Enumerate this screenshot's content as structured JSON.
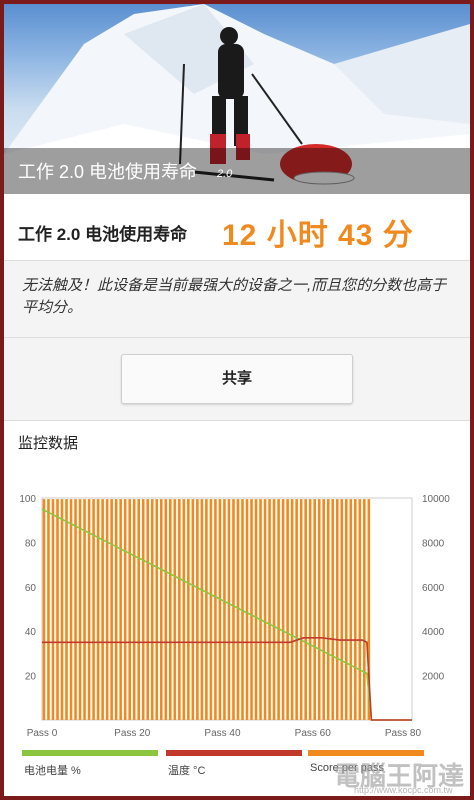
{
  "hero": {
    "title": "工作 2.0 电池使用寿命",
    "version": "2.0"
  },
  "result": {
    "label": "工作 2.0 电池使用寿命",
    "value": "12 小时 43 分"
  },
  "message": "无法触及！此设备是当前最强大的设备之一,而且您的分数也高于平均分。",
  "share_label": "共享",
  "monitor_title": "监控数据",
  "colors": {
    "battery": "#8cc63f",
    "temperature": "#c0392b",
    "score": "#f08a1e",
    "accent": "#f08a1e"
  },
  "chart_data": {
    "type": "line",
    "x_ticks": [
      "Pass 0",
      "Pass 20",
      "Pass 40",
      "Pass 60",
      "Pass 80"
    ],
    "y_left_ticks": [
      "100",
      "80",
      "60",
      "40",
      "20"
    ],
    "y_right_ticks": [
      "10000",
      "8000",
      "6000",
      "4000",
      "2000"
    ],
    "ylim_left": [
      0,
      100
    ],
    "ylim_right": [
      0,
      10000
    ],
    "xlim": [
      0,
      82
    ],
    "series": [
      {
        "name": "电池电量 %",
        "axis": "left",
        "points": [
          [
            0,
            95
          ],
          [
            72,
            21
          ],
          [
            73,
            0
          ],
          [
            82,
            0
          ]
        ]
      },
      {
        "name": "温度 °C",
        "axis": "left",
        "points": [
          [
            0,
            35
          ],
          [
            20,
            35
          ],
          [
            55,
            35
          ],
          [
            58,
            37
          ],
          [
            62,
            37
          ],
          [
            66,
            36
          ],
          [
            71,
            36
          ],
          [
            72,
            35
          ],
          [
            73,
            0
          ],
          [
            82,
            0
          ]
        ]
      },
      {
        "name": "Score per pass",
        "axis": "right",
        "bars": {
          "from": 0,
          "to": 72,
          "value": 9950
        }
      }
    ]
  }
}
